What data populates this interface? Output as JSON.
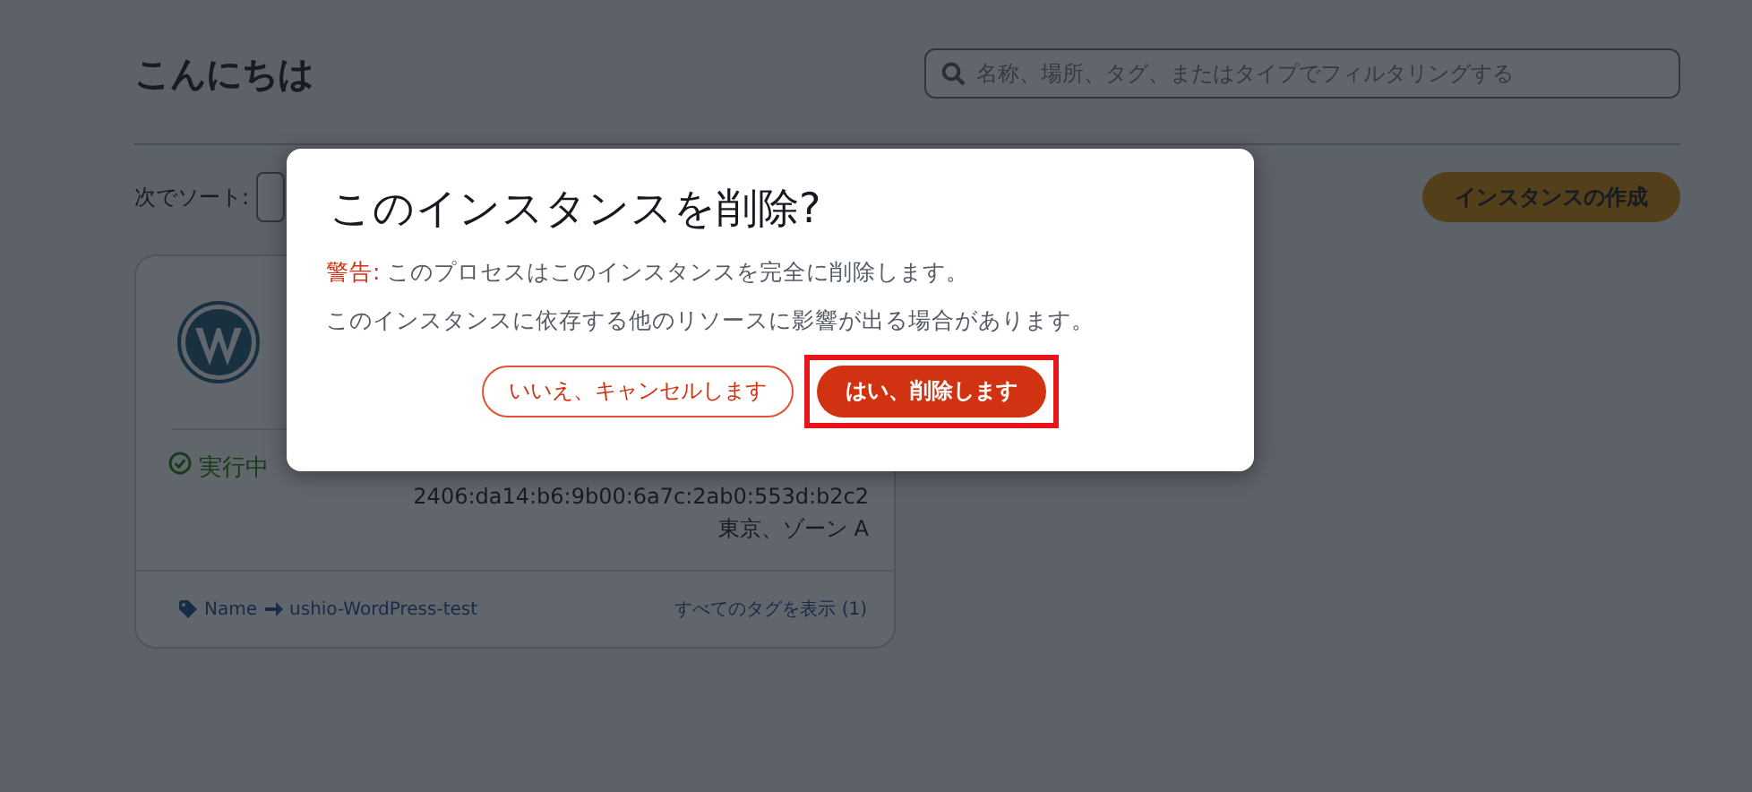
{
  "page": {
    "greeting": "こんにちは",
    "search": {
      "placeholder": "名称、場所、タグ、またはタイプでフィルタリングする"
    },
    "sort_label": "次でソート:",
    "create_button": "インスタンスの作成"
  },
  "instance_card": {
    "status": "実行中",
    "ip": "2406:da14:b6:9b00:6a7c:2ab0:553d:b2c2",
    "location": "東京、ゾーン A",
    "tag_key": "Name",
    "tag_value": "ushio-WordPress-test",
    "tags_link": "すべてのタグを表示 (1)"
  },
  "dialog": {
    "title": "このインスタンスを削除?",
    "warning_label": "警告:",
    "warning_text": "このプロセスはこのインスタンスを完全に削除します。",
    "note": "このインスタンスに依存する他のリソースに影響が出る場合があります。",
    "cancel_button": "いいえ、キャンセルします",
    "confirm_button": "はい、削除します",
    "confirm_highlighted": true
  }
}
